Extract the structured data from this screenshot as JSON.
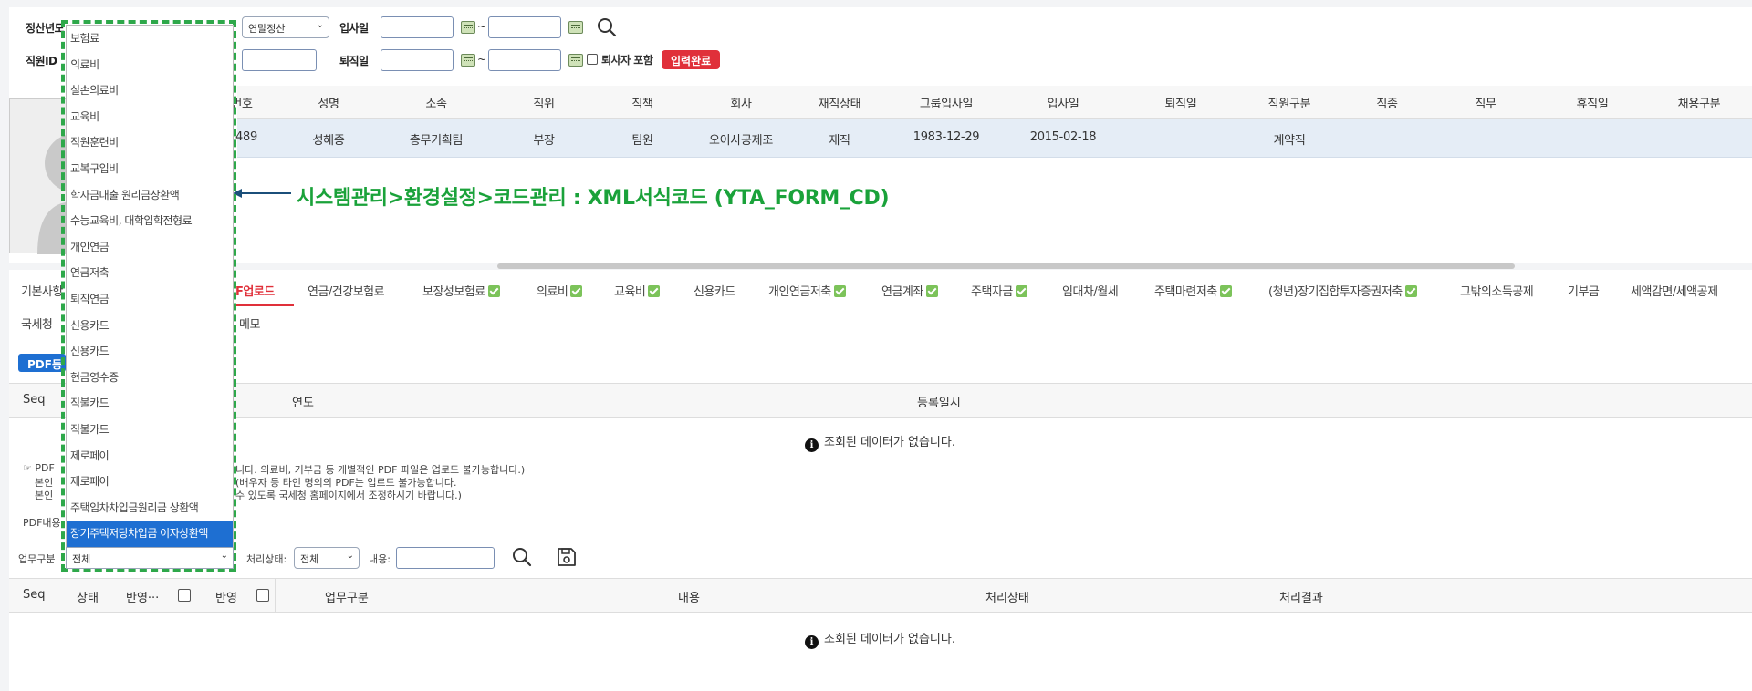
{
  "filters": {
    "year_label": "정산년도",
    "settle_type": "연말정산",
    "hire_date_label": "입사일",
    "employee_id_label": "직원ID",
    "retire_date_label": "퇴직일",
    "include_retired_label": "퇴사자 포함",
    "input_done_label": "입력완료",
    "tilde": "~"
  },
  "employee_table": {
    "headers": [
      "번호",
      "성명",
      "소속",
      "직위",
      "직책",
      "회사",
      "재직상태",
      "그룹입사일",
      "입사일",
      "퇴직일",
      "직원구분",
      "직종",
      "직무",
      "휴직일",
      "채용구분"
    ],
    "row": [
      "489",
      "성해종",
      "총무기획팀",
      "부장",
      "팀원",
      "오이사공제조",
      "재직",
      "1983-12-29",
      "2015-02-18",
      "",
      "계약직",
      "",
      "",
      "",
      ""
    ]
  },
  "annotation": "시스템관리>환경설정>코드관리 : XML서식코드 (YTA_FORM_CD)",
  "tabs_row1": [
    {
      "label": "기본사항",
      "checked": false
    },
    {
      "label": "PDF업로드",
      "checked": false,
      "active": true
    },
    {
      "label": "연금/건강보험료",
      "checked": false
    },
    {
      "label": "보장성보험료",
      "checked": true
    },
    {
      "label": "의료비",
      "checked": true
    },
    {
      "label": "교육비",
      "checked": true
    },
    {
      "label": "신용카드",
      "checked": false
    },
    {
      "label": "개인연금저축",
      "checked": true
    },
    {
      "label": "연금계좌",
      "checked": true
    },
    {
      "label": "주택자금",
      "checked": true
    },
    {
      "label": "임대차/월세",
      "checked": false
    },
    {
      "label": "주택마련저축",
      "checked": true
    },
    {
      "label": "(청년)장기집합투자증권저축",
      "checked": true
    },
    {
      "label": "그밖의소득공제",
      "checked": false
    },
    {
      "label": "기부금",
      "checked": false
    },
    {
      "label": "세액감면/세액공제",
      "checked": false
    }
  ],
  "tabs_row2": [
    "국세청",
    "메모"
  ],
  "pdf_button": "PDF등",
  "upload_table": {
    "headers": [
      "Seq",
      "연도",
      "등록일시"
    ],
    "empty_message": "조회된 데이터가 없습니다."
  },
  "notes": {
    "line1_prefix": "☞ PDF",
    "line1": "니다. 의료비, 기부금 등 개별적인 PDF 파일은 업로드 불가능합니다.)",
    "line2_prefix": "본인",
    "line2": "(배우자 등 타인 명의의 PDF는 업로드 불가능합니다.",
    "line3_prefix": "본인",
    "line3": "수 있도록 국세청 홈페이지에서 조정하시기 바랍니다.)",
    "pdf_content_label": "PDF내용"
  },
  "bottom_filters": {
    "work_type_label": "업무구분",
    "work_type_value": "전체",
    "process_state_label": "처리상태:",
    "process_state_value": "전체",
    "content_label": "내용:"
  },
  "result_table": {
    "headers": [
      "Seq",
      "상태",
      "반영···",
      "반영",
      "업무구분",
      "내용",
      "처리상태",
      "처리결과"
    ],
    "empty_message": "조회된 데이터가 없습니다."
  },
  "dropdown": {
    "items": [
      "보험료",
      "의료비",
      "실손의료비",
      "교육비",
      "직원훈련비",
      "교복구입비",
      "학자금대출 원리금상환액",
      "수능교육비, 대학입학전형료",
      "개인연금",
      "연금저축",
      "퇴직연금",
      "신용카드",
      "신용카드",
      "현금영수증",
      "직불카드",
      "직불카드",
      "제로페이",
      "제로페이",
      "주택임차차입금원리금 상환액",
      "장기주택저당차입금 이자상환액"
    ],
    "selected_index": 19
  },
  "colors": {
    "accent_red": "#e0303a",
    "annotation_green": "#1aa23a",
    "tab_check_green": "#7cc35a",
    "selected_blue": "#1e6fd2",
    "dashed_border": "#2ea84a"
  }
}
